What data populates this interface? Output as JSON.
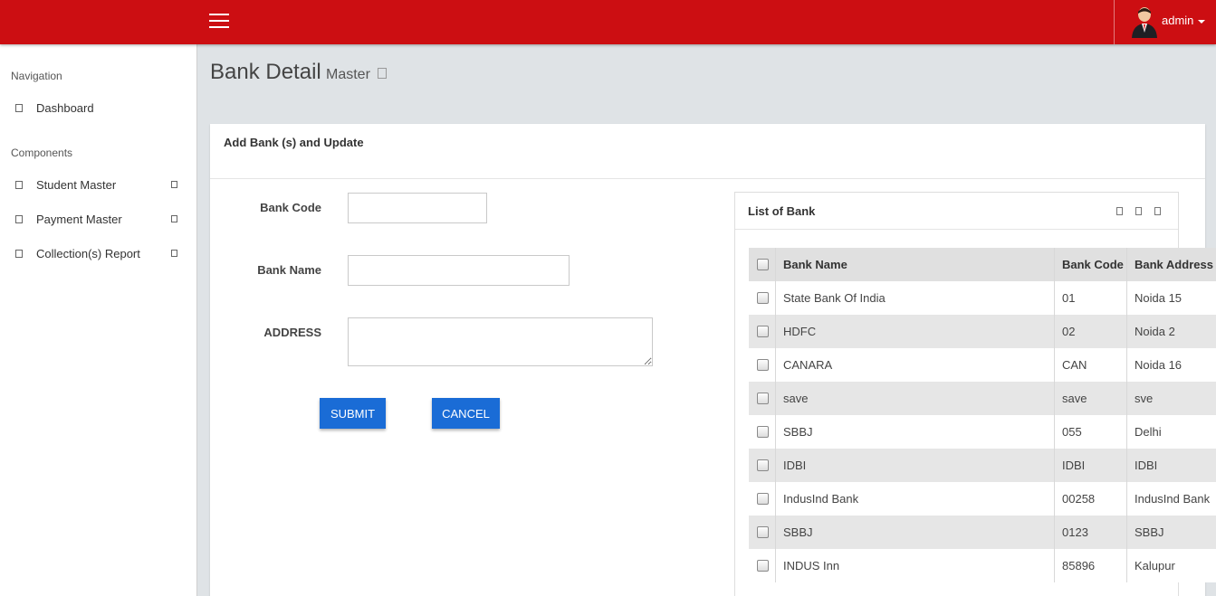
{
  "header": {
    "menu_icon": "hamburger-icon",
    "user_name": "admin",
    "avatar_icon": "user-avatar-icon"
  },
  "sidebar": {
    "navigation_title": "Navigation",
    "components_title": "Components",
    "items": [
      {
        "label": "Dashboard",
        "icon": "dashboard-icon"
      },
      {
        "label": "Student Master",
        "icon": "student-icon"
      },
      {
        "label": "Payment Master",
        "icon": "payment-icon"
      },
      {
        "label": "Collection(s) Report",
        "icon": "report-icon"
      }
    ]
  },
  "page": {
    "title": "Bank Detail",
    "subtitle": "Master"
  },
  "form": {
    "panel_title": "Add Bank (s) and Update",
    "bank_code_label": "Bank Code",
    "bank_code_value": "",
    "bank_name_label": "Bank Name",
    "bank_name_value": "",
    "address_label": "ADDRESS",
    "address_value": "",
    "submit_label": "SUBMIT",
    "cancel_label": "CANCEL"
  },
  "bank_list": {
    "title": "List of Bank",
    "columns": [
      "Bank Name",
      "Bank Code",
      "Bank Address"
    ],
    "rows": [
      [
        "State Bank Of India",
        "01",
        "Noida 15"
      ],
      [
        "HDFC",
        "02",
        "Noida 2"
      ],
      [
        "CANARA",
        "CAN",
        "Noida 16"
      ],
      [
        "save",
        "save",
        "sve"
      ],
      [
        "SBBJ",
        "055",
        "Delhi"
      ],
      [
        "IDBI",
        "IDBI",
        "IDBI"
      ],
      [
        "IndusInd Bank",
        "00258",
        "IndusInd Bank"
      ],
      [
        "SBBJ",
        "0123",
        "SBBJ"
      ],
      [
        "INDUS Inn",
        "85896",
        "Kalupur"
      ]
    ]
  },
  "colors": {
    "header_bg": "#cc0e12",
    "button_bg": "#1a6cd6",
    "page_bg": "#dfe3e6"
  }
}
